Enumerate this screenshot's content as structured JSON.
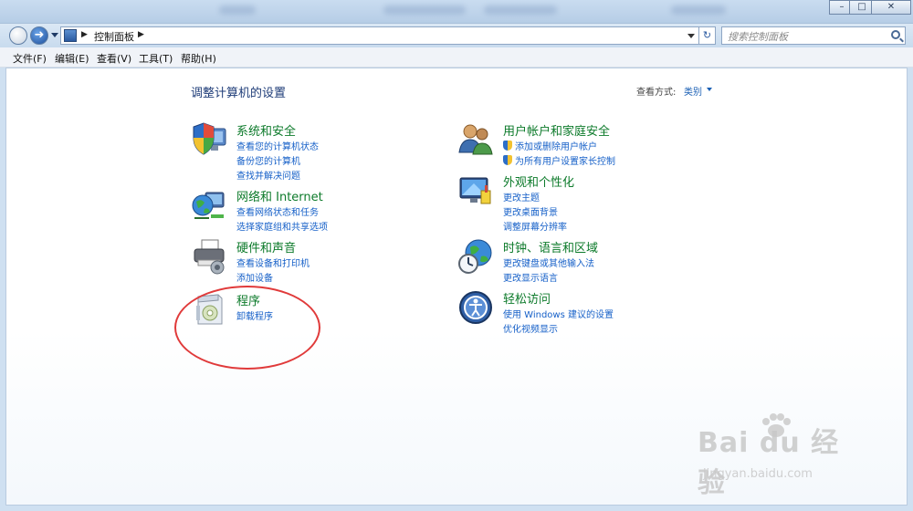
{
  "addressbar": {
    "path": "控制面板",
    "search_placeholder": "搜索控制面板"
  },
  "menubar": [
    "文件(F)",
    "编辑(E)",
    "查看(V)",
    "工具(T)",
    "帮助(H)"
  ],
  "main": {
    "title": "调整计算机的设置",
    "view_by_label": "查看方式:",
    "view_by_value": "类别"
  },
  "categories": [
    {
      "icon": "shield-computer-icon",
      "title": "系统和安全",
      "links": [
        "查看您的计算机状态",
        "备份您的计算机",
        "查找并解决问题"
      ]
    },
    {
      "icon": "network-globe-icon",
      "title": "网络和 Internet",
      "links": [
        "查看网络状态和任务",
        "选择家庭组和共享选项"
      ]
    },
    {
      "icon": "printer-icon",
      "title": "硬件和声音",
      "links": [
        "查看设备和打印机",
        "添加设备"
      ]
    },
    {
      "icon": "program-box-icon",
      "title": "程序",
      "links": [
        "卸载程序"
      ]
    },
    {
      "icon": "users-icon",
      "title": "用户帐户和家庭安全",
      "links": [
        "添加或删除用户帐户",
        "为所有用户设置家长控制"
      ]
    },
    {
      "icon": "monitor-personalize-icon",
      "title": "外观和个性化",
      "links": [
        "更改主题",
        "更改桌面背景",
        "调整屏幕分辨率"
      ]
    },
    {
      "icon": "clock-globe-icon",
      "title": "时钟、语言和区域",
      "links": [
        "更改键盘或其他输入法",
        "更改显示语言"
      ]
    },
    {
      "icon": "ease-of-access-icon",
      "title": "轻松访问",
      "links": [
        "使用 Windows 建议的设置",
        "优化视频显示"
      ]
    }
  ],
  "watermark": {
    "logo": "Bai du 经验",
    "url": "jingyan.baidu.com"
  },
  "colors": {
    "category_title": "#0c7a2a",
    "link": "#1660c8",
    "annotation_circle": "#e03a3a"
  }
}
